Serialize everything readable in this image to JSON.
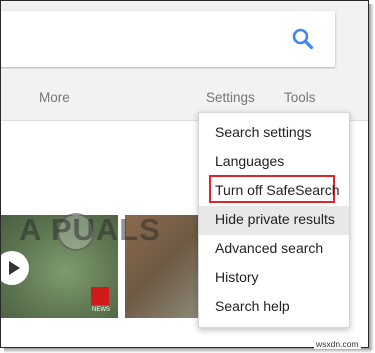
{
  "nav": {
    "more": "More",
    "settings": "Settings",
    "tools": "Tools"
  },
  "watermark": "A  PUALS",
  "thumbnail_badge": "NEWS",
  "settings_menu": {
    "items": [
      {
        "label": "Search settings"
      },
      {
        "label": "Languages"
      },
      {
        "label": "Turn off SafeSearch"
      },
      {
        "label": "Hide private results"
      },
      {
        "label": "Advanced search"
      },
      {
        "label": "History"
      },
      {
        "label": "Search help"
      }
    ]
  },
  "footer": {
    "credit": "wsxdn.com"
  },
  "colors": {
    "search_icon": "#4285f4",
    "highlight_border": "#e0262c",
    "hover_bg": "#e8e8e8"
  },
  "icons": {
    "search": "search-icon",
    "play": "play-icon"
  }
}
